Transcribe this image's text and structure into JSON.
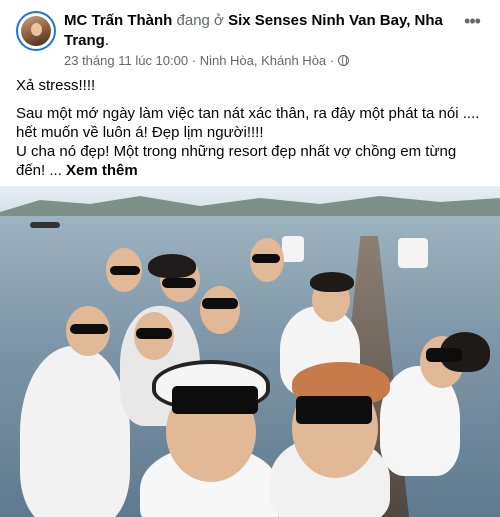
{
  "post": {
    "author": "MC Trấn Thành",
    "location_connector": "đang ở",
    "location": "Six Senses Ninh Van Bay, Nha Trang",
    "timestamp": "23 tháng 11 lúc 10:00",
    "separator": "·",
    "place": "Ninh Hòa, Khánh Hòa",
    "audience_icon": "globe-icon",
    "more_icon": "more-horizontal-icon",
    "text_line_1": "Xả stress!!!!",
    "text_paragraph_2": "Sau một mớ ngày làm việc tan nát xác thân, ra đây một phát ta nói .... hết muốn về luôn á! Đẹp lịm người!!!!",
    "text_paragraph_3": "U cha nó đẹp! Một trong những resort đẹp nhất vợ chồng em từng đến! ...",
    "see_more": "Xem thêm"
  },
  "colors": {
    "text": "#050505",
    "muted": "#65676b",
    "avatar_ring": "#1b74e4"
  }
}
